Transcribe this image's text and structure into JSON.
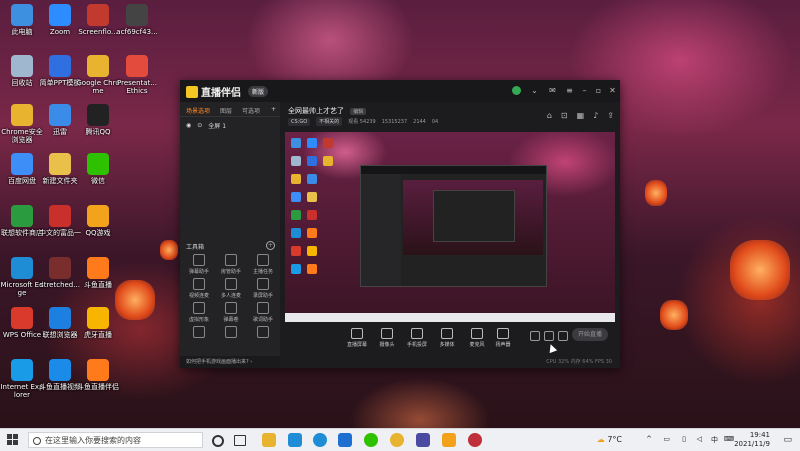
{
  "desktop": {
    "icons": [
      {
        "label": "此电脑",
        "icon": "computer-icon",
        "color": "#3d8fe0"
      },
      {
        "label": "Zoom",
        "icon": "zoom-icon",
        "color": "#2d8cff"
      },
      {
        "label": "Screenflo...",
        "icon": "screenflow-icon",
        "color": "#c23a2e"
      },
      {
        "label": "acf69cf43...",
        "icon": "file-icon",
        "color": "#444444"
      },
      {
        "label": "回收站",
        "icon": "recycle-bin-icon",
        "color": "#9fb7cf"
      },
      {
        "label": "简单PPT模板",
        "icon": "ppt-template-icon",
        "color": "#2f6fe0"
      },
      {
        "label": "Google Chrome",
        "icon": "chrome-icon",
        "color": "#e8b32e"
      },
      {
        "label": "Presentat... Ethics",
        "icon": "pdf-icon",
        "color": "#e34b3c"
      },
      {
        "label": "Chrome安全浏览器",
        "icon": "chrome-secure-icon",
        "color": "#e8b32e"
      },
      {
        "label": "迅雷",
        "icon": "xunlei-icon",
        "color": "#3b8ce8"
      },
      {
        "label": "腾讯QQ",
        "icon": "qq-icon",
        "color": "#222222"
      },
      {
        "label": "百度网盘",
        "icon": "baidu-netdisk-icon",
        "color": "#3e8ef7"
      },
      {
        "label": "新建文件夹",
        "icon": "folder-icon",
        "color": "#e9c04a"
      },
      {
        "label": "微信",
        "icon": "wechat-icon",
        "color": "#2dc100"
      },
      {
        "label": "联想软件商店",
        "icon": "lenovo-store-icon",
        "color": "#2b9b3f"
      },
      {
        "label": "中文的富品一",
        "icon": "app-icon",
        "color": "#c9302c"
      },
      {
        "label": "QQ游戏",
        "icon": "qq-game-icon",
        "color": "#f2a31b"
      },
      {
        "label": "Microsoft Edge",
        "icon": "edge-icon",
        "color": "#1f8dd6"
      },
      {
        "label": "stretched...",
        "icon": "image-icon",
        "color": "#7a2d2d"
      },
      {
        "label": "斗鱼直播",
        "icon": "douyu-icon",
        "color": "#ff7a1a"
      },
      {
        "label": "WPS Office",
        "icon": "wps-icon",
        "color": "#d93a2b"
      },
      {
        "label": "联想浏览器",
        "icon": "lenovo-browser-icon",
        "color": "#1d7fe0"
      },
      {
        "label": "虎牙直播",
        "icon": "huya-icon",
        "color": "#f7b500"
      },
      {
        "label": "Internet Explorer",
        "icon": "ie-icon",
        "color": "#1a9be8"
      },
      {
        "label": "斗鱼直播视频",
        "icon": "douyu-video-icon",
        "color": "#1a8be8"
      },
      {
        "label": "斗鱼直播伴侣",
        "icon": "douyu-companion-icon",
        "color": "#ff7a1a"
      }
    ]
  },
  "app": {
    "title": "直播伴侣",
    "version": "新版",
    "left_tabs": [
      "场景选项",
      "图层",
      "可选项"
    ],
    "scene_label": "全屏 1",
    "tools_title": "工具箱",
    "tools": [
      "弹幕助手",
      "房管助手",
      "主播任务",
      "视频连麦",
      "多人连麦",
      "录屏助手",
      "虚拟形象",
      "弹幕卷",
      "歌词助手",
      "",
      "",
      ""
    ],
    "notice": "如何把手机游戏画面播出来?",
    "room_title": "全网最帅上才艺了",
    "room_tag": "编辑",
    "room_category": "CS:GO",
    "room_category2": "不相关的",
    "room_stats": [
      "观看 54239",
      "15315237",
      "2144",
      "04"
    ],
    "controls": [
      "直播屏幕",
      "摄像头",
      "手机投屏",
      "多媒体",
      "麦克风",
      "扬声器"
    ],
    "start_button": "开始直播",
    "status": "CPU 32%  内存 64%  FPS 30"
  },
  "taskbar": {
    "search_placeholder": "在这里输入你要搜索的内容",
    "weather": "7°C",
    "time": "19:41",
    "date": "2021/11/9"
  }
}
